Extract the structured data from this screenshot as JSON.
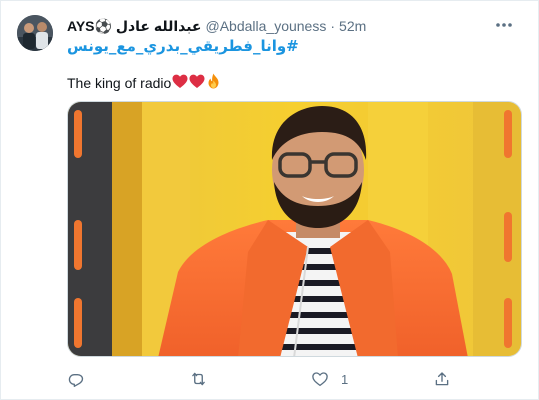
{
  "tweet": {
    "display_name": "AYS⚽ عبدالله عادل",
    "handle": "@Abdalla_youness",
    "separator": "·",
    "time": "52m",
    "hashtag": "#وانا_فطريقي_بدري_مع_يونس",
    "text": "The king of radio",
    "emojis": [
      "red-heart",
      "red-heart",
      "fire"
    ],
    "media_alt": "photo of a smiling man with glasses and a beard wearing an orange jacket over a striped shirt"
  },
  "actions": {
    "reply": {
      "icon": "reply-icon",
      "count": ""
    },
    "retweet": {
      "icon": "retweet-icon",
      "count": ""
    },
    "like": {
      "icon": "heart-icon",
      "count": "1"
    },
    "share": {
      "icon": "share-icon",
      "count": ""
    }
  },
  "colors": {
    "link": "#1b95e0",
    "secondary_text": "#5b7083",
    "border": "#e6ecf0"
  }
}
